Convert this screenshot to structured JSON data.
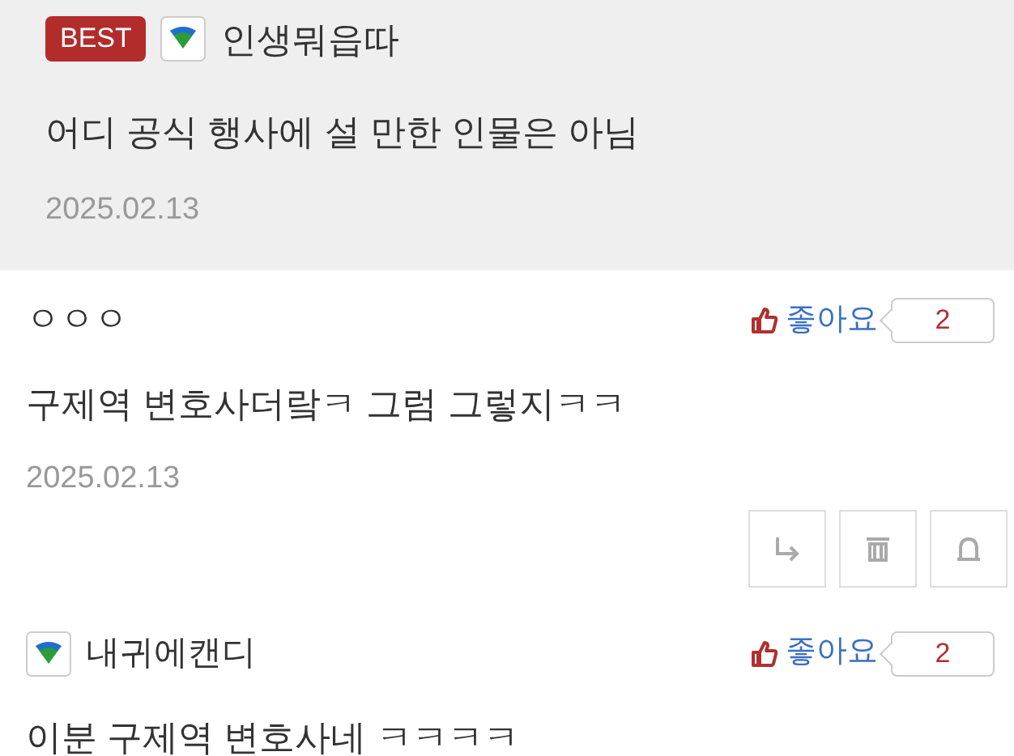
{
  "comments": [
    {
      "kind": "best",
      "badge": "BEST",
      "has_level_icon": true,
      "author": "인생뭐읍따",
      "text": "어디 공식 행사에 설 만한 인물은 아님",
      "date": "2025.02.13"
    },
    {
      "kind": "normal",
      "has_level_icon": false,
      "author": "ㅇㅇㅇ",
      "like_label": "좋아요",
      "like_count": "2",
      "text": "구제역 변호사더랔ㅋ 그럼 그렇지ㅋㅋ",
      "date": "2025.02.13",
      "actions": true
    },
    {
      "kind": "normal",
      "has_level_icon": true,
      "author": "내귀에캔디",
      "like_label": "좋아요",
      "like_count": "2",
      "text": "이분 구제역 변호사네 ㅋㅋㅋㅋ"
    }
  ]
}
